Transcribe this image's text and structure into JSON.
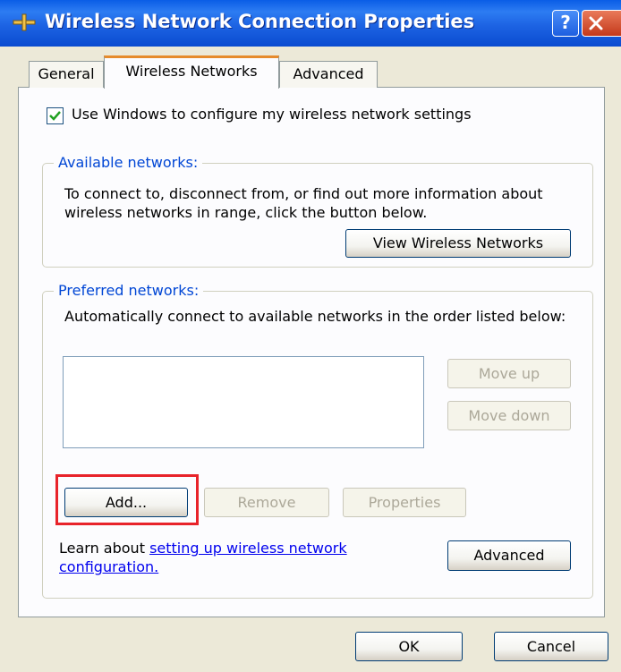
{
  "window": {
    "title": "Wireless Network Connection Properties",
    "help_glyph": "?",
    "colors": {
      "titlebar": "#0A5DE6",
      "close": "#C4391B",
      "legend": "#0046D5",
      "highlight": "#E8232A"
    }
  },
  "tabs": [
    {
      "label": "General"
    },
    {
      "label": "Wireless Networks",
      "selected": true
    },
    {
      "label": "Advanced"
    }
  ],
  "use_windows": {
    "label": "Use Windows to configure my wireless network settings",
    "checked": true
  },
  "available": {
    "legend": "Available networks:",
    "description": "To connect to, disconnect from, or find out more information about wireless networks in range, click the button below.",
    "view_button": "View Wireless Networks"
  },
  "preferred": {
    "legend": "Preferred networks:",
    "description": "Automatically connect to available networks in the order listed below:",
    "move_up": "Move up",
    "move_down": "Move down",
    "add": "Add...",
    "remove": "Remove",
    "properties": "Properties"
  },
  "learn": {
    "prefix": "Learn about ",
    "link": "setting up wireless network configuration."
  },
  "advanced_button": "Advanced",
  "footer": {
    "ok": "OK",
    "cancel": "Cancel"
  }
}
